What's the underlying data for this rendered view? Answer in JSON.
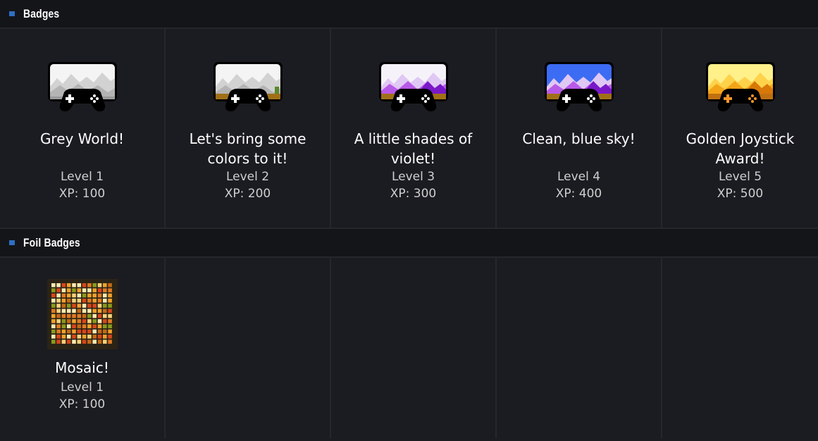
{
  "sections": [
    {
      "title": "Badges",
      "badges": [
        {
          "name": "Grey World!",
          "level": "Level 1",
          "xp": "XP: 100",
          "icon": "grey-controller-badge-icon"
        },
        {
          "name": "Let's bring some colors to it!",
          "level": "Level 2",
          "xp": "XP: 200",
          "icon": "colors-controller-badge-icon"
        },
        {
          "name": "A little shades of violet!",
          "level": "Level 3",
          "xp": "XP: 300",
          "icon": "violet-controller-badge-icon"
        },
        {
          "name": "Clean, blue sky!",
          "level": "Level 4",
          "xp": "XP: 400",
          "icon": "blue-sky-controller-badge-icon"
        },
        {
          "name": "Golden Joystick Award!",
          "level": "Level 5",
          "xp": "XP: 500",
          "icon": "golden-controller-badge-icon"
        }
      ]
    },
    {
      "title": "Foil Badges",
      "badges": [
        {
          "name": "Mosaic!",
          "level": "Level 1",
          "xp": "XP: 100",
          "icon": "mosaic-badge-icon"
        }
      ]
    }
  ],
  "colors": {
    "accent": "#2e6fc4",
    "background": "#1b1c21",
    "header_background": "#141519"
  }
}
